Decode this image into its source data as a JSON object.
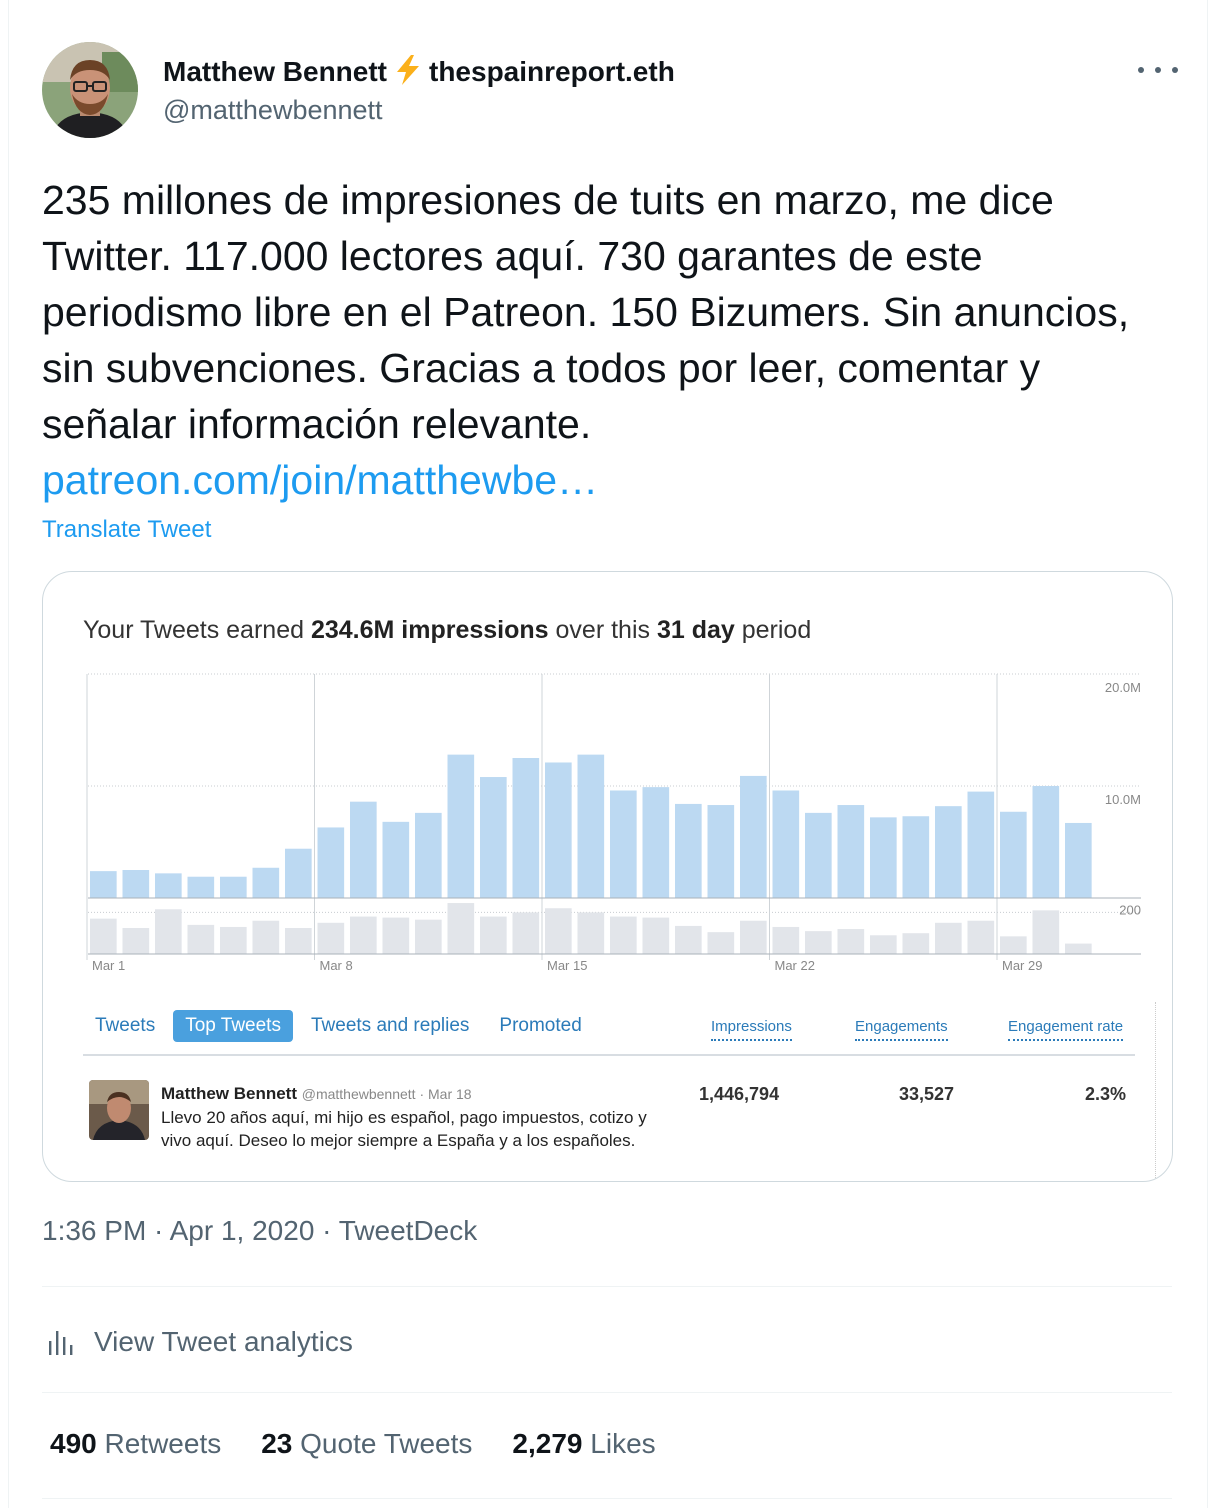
{
  "tweet": {
    "author_name": "Matthew Bennett",
    "author_suffix": "thespainreport.eth",
    "author_handle": "@matthewbennett",
    "text": "235 millones de impresiones de tuits en marzo, me dice Twitter. 117.000 lectores aquí. 730 garantes de este periodismo libre en el Patreon. 150 Bizumers. Sin anuncios, sin subvenciones. Gracias a todos por leer, comentar y señalar información relevante.",
    "link": "patreon.com/join/matthewbe…",
    "translate_label": "Translate Tweet",
    "timestamp": "1:36 PM · Apr 1, 2020 · TweetDeck",
    "analytics_label": "View Tweet analytics",
    "stats": {
      "retweets_count": "490",
      "retweets_label": "Retweets",
      "quotes_count": "23",
      "quotes_label": "Quote Tweets",
      "likes_count": "2,279",
      "likes_label": "Likes"
    }
  },
  "card": {
    "title_pre": "Your Tweets earned ",
    "title_bold1": "234.6M impressions",
    "title_mid": " over this ",
    "title_bold2": "31 day",
    "title_post": " period",
    "tabs": [
      "Tweets",
      "Top Tweets",
      "Tweets and replies",
      "Promoted"
    ],
    "active_tab": "Top Tweets",
    "columns": [
      "Impressions",
      "Engagements",
      "Engagement rate"
    ],
    "top_tweet": {
      "name": "Matthew Bennett",
      "meta": "@matthewbennett · Mar 18",
      "text": "Llevo 20 años aquí, mi hijo es español, pago impuestos, cotizo y vivo aquí. Deseo lo mejor siempre a España y a los españoles.",
      "impressions": "1,446,794",
      "engagements": "33,527",
      "rate": "2.3%"
    }
  },
  "chart_data": {
    "type": "bar",
    "x": [
      1,
      2,
      3,
      4,
      5,
      6,
      7,
      8,
      9,
      10,
      11,
      12,
      13,
      14,
      15,
      16,
      17,
      18,
      19,
      20,
      21,
      22,
      23,
      24,
      25,
      26,
      27,
      28,
      29,
      30,
      31
    ],
    "x_tick_labels": [
      "Mar 1",
      "Mar 8",
      "Mar 15",
      "Mar 22",
      "Mar 29"
    ],
    "x_tick_days": [
      1,
      8,
      15,
      22,
      29
    ],
    "series": [
      {
        "values": [
          2.4,
          2.5,
          2.2,
          1.9,
          1.9,
          2.7,
          4.4,
          6.3,
          8.6,
          6.8,
          7.6,
          12.8,
          10.8,
          12.5,
          12.1,
          12.8,
          9.6,
          9.9,
          8.4,
          8.3,
          10.9,
          9.6,
          7.6,
          8.3,
          7.2,
          7.3,
          8.2,
          9.5,
          7.7,
          10.0,
          6.7
        ],
        "unit": "M",
        "y_ticks": [
          "20.0M",
          "10.0M"
        ],
        "ylim": [
          0,
          20
        ],
        "color": "#bcd9f2"
      },
      {
        "values": [
          170,
          125,
          215,
          140,
          130,
          160,
          125,
          150,
          180,
          175,
          165,
          245,
          180,
          200,
          220,
          200,
          180,
          175,
          135,
          105,
          160,
          130,
          110,
          120,
          90,
          100,
          150,
          160,
          85,
          210,
          50
        ],
        "y_ticks": [
          "200"
        ],
        "ylim": [
          0,
          250
        ],
        "color": "#e2e5ea"
      }
    ],
    "grid": true
  },
  "colors": {
    "accent": "#1d9bf0",
    "secondary_text": "#536471",
    "card_link": "#2b7bb9",
    "bolt": "#fbb01a"
  }
}
